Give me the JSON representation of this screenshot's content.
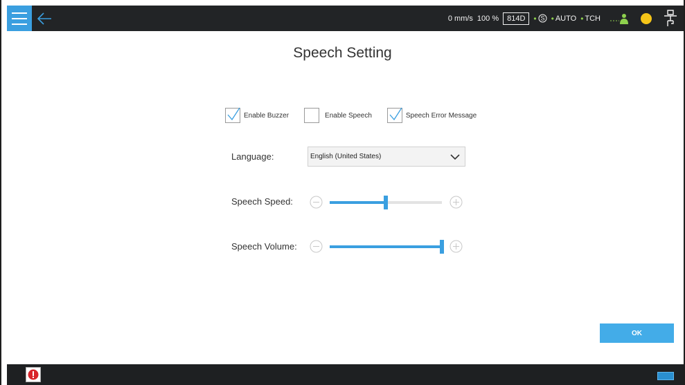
{
  "topbar": {
    "speed": "0 mm/s",
    "override": "100 %",
    "box_code": "814D",
    "mode_auto": "AUTO",
    "mode_tch": "TCH"
  },
  "page": {
    "title": "Speech Setting"
  },
  "options": {
    "enable_buzzer": {
      "label": "Enable Buzzer",
      "checked": true
    },
    "enable_speech": {
      "label": "Enable Speech",
      "checked": false
    },
    "speech_error_message": {
      "label": "Speech Error Message",
      "checked": true
    }
  },
  "language": {
    "label": "Language:",
    "value": "English (United States)"
  },
  "speech_speed": {
    "label": "Speech Speed:",
    "level": 0.5
  },
  "speech_volume": {
    "label": "Speech Volume:",
    "level": 1.0
  },
  "actions": {
    "ok_label": "OK"
  },
  "colors": {
    "accent": "#3a9fe0",
    "topbar": "#222426",
    "status_green": "#8ed14e",
    "indicator_yellow": "#f5c518",
    "alarm_red": "#d9262c"
  }
}
